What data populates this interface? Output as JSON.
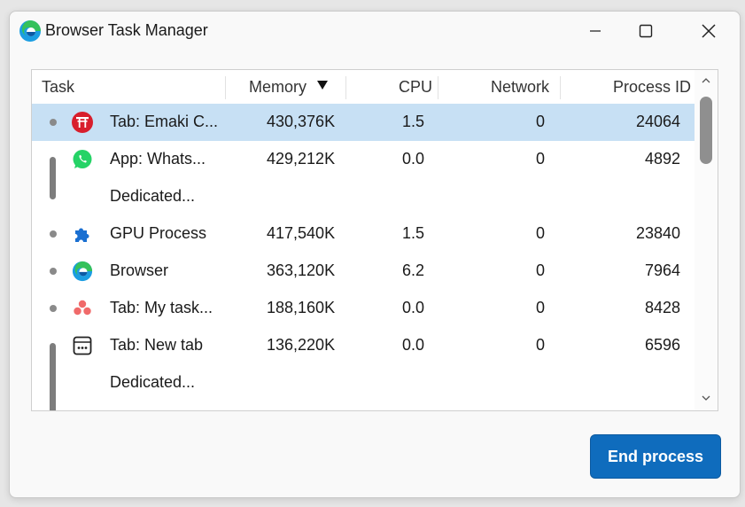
{
  "window": {
    "title": "Browser Task Manager"
  },
  "table": {
    "columns": {
      "task": "Task",
      "memory": "Memory",
      "cpu": "CPU",
      "network": "Network",
      "pid": "Process ID"
    },
    "sort": {
      "column": "Memory",
      "direction": "descending"
    },
    "rows": [
      {
        "task": "Tab: Emaki C...",
        "memory": "430,376K",
        "cpu": "1.5",
        "network": "0",
        "pid": "24064",
        "icon": "torii-gate-icon",
        "selected": true
      },
      {
        "task": "App: Whats...",
        "memory": "429,212K",
        "cpu": "0.0",
        "network": "0",
        "pid": "4892",
        "icon": "whatsapp-icon"
      },
      {
        "task": "Dedicated...",
        "memory": "",
        "cpu": "",
        "network": "",
        "pid": ""
      },
      {
        "task": "GPU Process",
        "memory": "417,540K",
        "cpu": "1.5",
        "network": "0",
        "pid": "23840",
        "icon": "puzzle-piece-icon"
      },
      {
        "task": "Browser",
        "memory": "363,120K",
        "cpu": "6.2",
        "network": "0",
        "pid": "7964",
        "icon": "edge-logo-icon"
      },
      {
        "task": "Tab: My task...",
        "memory": "188,160K",
        "cpu": "0.0",
        "network": "0",
        "pid": "8428",
        "icon": "three-dots-cluster-icon"
      },
      {
        "task": "Tab: New tab",
        "memory": "136,220K",
        "cpu": "0.0",
        "network": "0",
        "pid": "6596",
        "icon": "new-tab-page-icon"
      },
      {
        "task": "Dedicated...",
        "memory": "",
        "cpu": "",
        "network": "",
        "pid": ""
      }
    ]
  },
  "buttons": {
    "end_process": "End process"
  },
  "colors": {
    "accent": "#0f6cbd",
    "selection": "#c7e0f4"
  }
}
